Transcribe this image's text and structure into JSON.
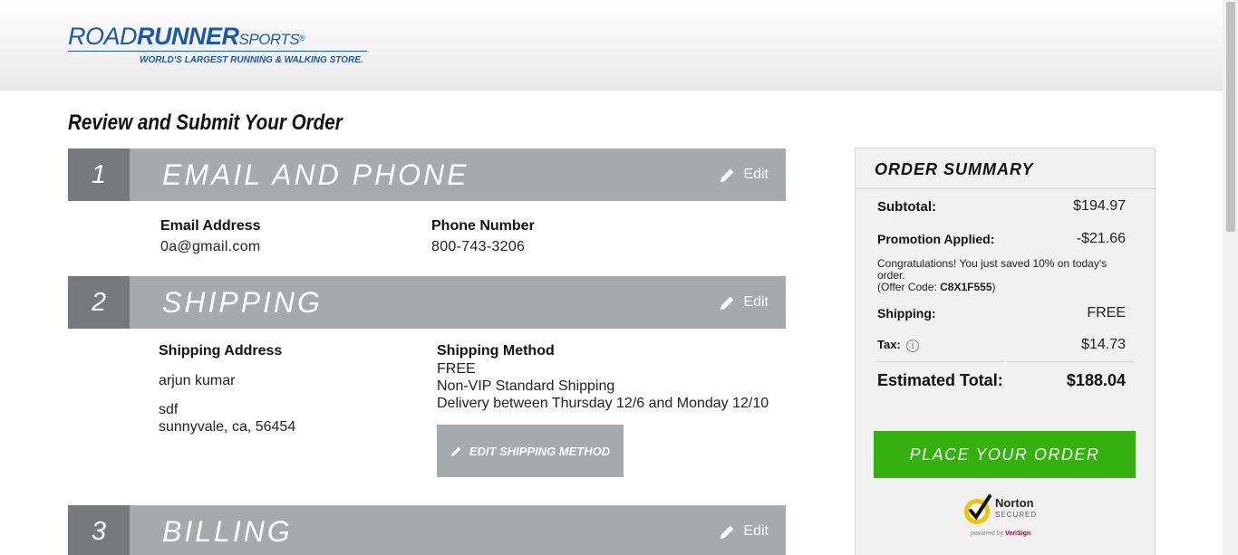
{
  "brand": {
    "name_road": "ROAD",
    "name_runner": "RUNNER",
    "name_sports": "SPORTS",
    "registered": "®",
    "tagline": "WORLD'S LARGEST RUNNING & WALKING STORE."
  },
  "page": {
    "title": "Review and Submit Your Order"
  },
  "sections": {
    "email": {
      "number": "1",
      "title": "EMAIL AND PHONE",
      "edit_label": "Edit",
      "email_label": "Email Address",
      "email_value": "0a@gmail.com",
      "phone_label": "Phone Number",
      "phone_value": "800-743-3206"
    },
    "shipping": {
      "number": "2",
      "title": "SHIPPING",
      "edit_label": "Edit",
      "address_label": "Shipping Address",
      "name": "arjun kumar",
      "street": "sdf",
      "city_state_zip": "sunnyvale, ca, 56454",
      "method_label": "Shipping Method",
      "method_cost": "FREE",
      "method_name": "Non-VIP Standard Shipping",
      "method_delivery": "Delivery between Thursday 12/6 and Monday 12/10",
      "edit_method_label": "EDIT SHIPPING METHOD"
    },
    "billing": {
      "number": "3",
      "title": "BILLING",
      "edit_label": "Edit"
    }
  },
  "summary": {
    "title": "ORDER SUMMARY",
    "subtotal_label": "Subtotal:",
    "subtotal_value": "$194.97",
    "promo_label": "Promotion Applied:",
    "promo_value": "-$21.66",
    "promo_note": "Congratulations! You just saved 10% on today's order.",
    "offer_prefix": "(Offer Code: ",
    "offer_code": "C8X1F555",
    "offer_suffix": ")",
    "shipping_label": "Shipping:",
    "shipping_value": "FREE",
    "tax_label": "Tax:",
    "tax_info_glyph": "i",
    "tax_value": "$14.73",
    "total_label": "Estimated Total:",
    "total_value": "$188.04",
    "place_order_label": "PLACE YOUR ORDER"
  },
  "badge": {
    "brand": "Norton",
    "secured": "SECURED",
    "powered_prefix": "powered by ",
    "powered_brand": "VeriSign"
  },
  "colors": {
    "brand_blue": "#1b5aa8",
    "section_bar": "#a7aaad",
    "section_number": "#77797c",
    "place_order_green": "#35b10f",
    "norton_yellow": "#f5c400"
  },
  "icons": {
    "edit": "pencil-icon",
    "info": "info-icon",
    "norton": "norton-check-icon"
  }
}
